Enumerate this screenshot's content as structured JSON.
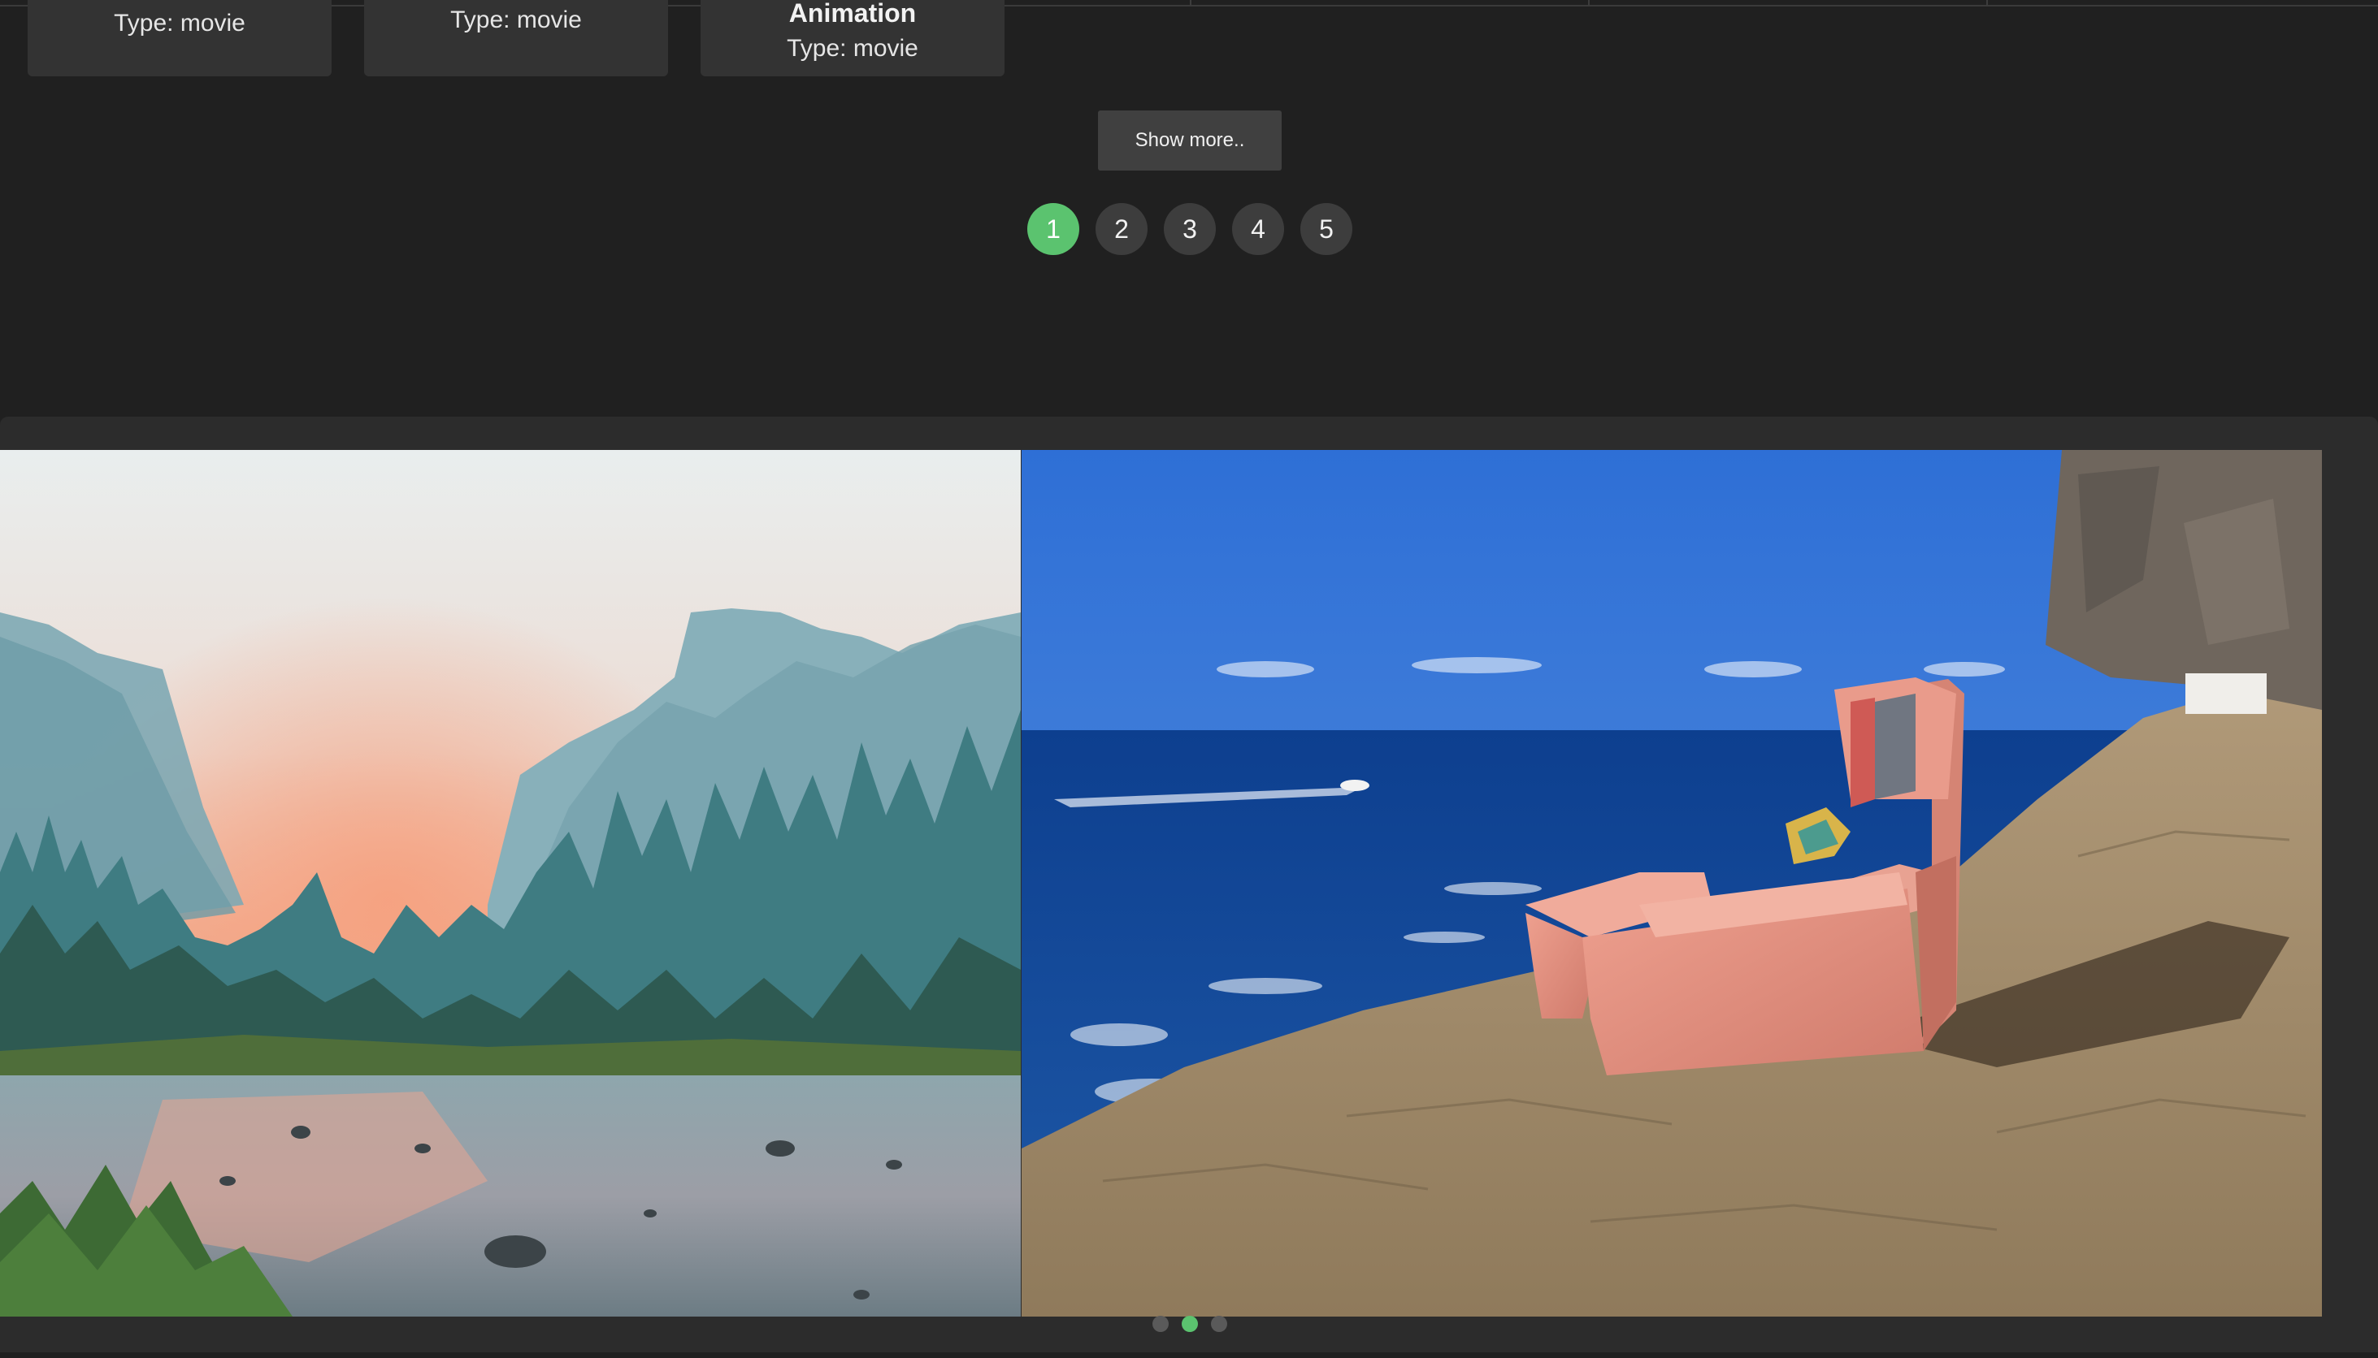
{
  "cards": [
    {
      "title": "",
      "type_text": "Type: movie"
    },
    {
      "title": "",
      "type_text": "Type: movie"
    },
    {
      "title": "Animation",
      "type_text": "Type: movie"
    }
  ],
  "show_more": {
    "label": "Show more.."
  },
  "pagination": {
    "pages": [
      "1",
      "2",
      "3",
      "4",
      "5"
    ],
    "active_page": "1",
    "active_color": "#5bc36f"
  },
  "slider": {
    "slides": [
      {
        "name": "mountain-valley-sunset-image"
      },
      {
        "name": "armchair-on-cliff-by-sea-image"
      }
    ],
    "active_index": 1,
    "dot_count": 3
  }
}
